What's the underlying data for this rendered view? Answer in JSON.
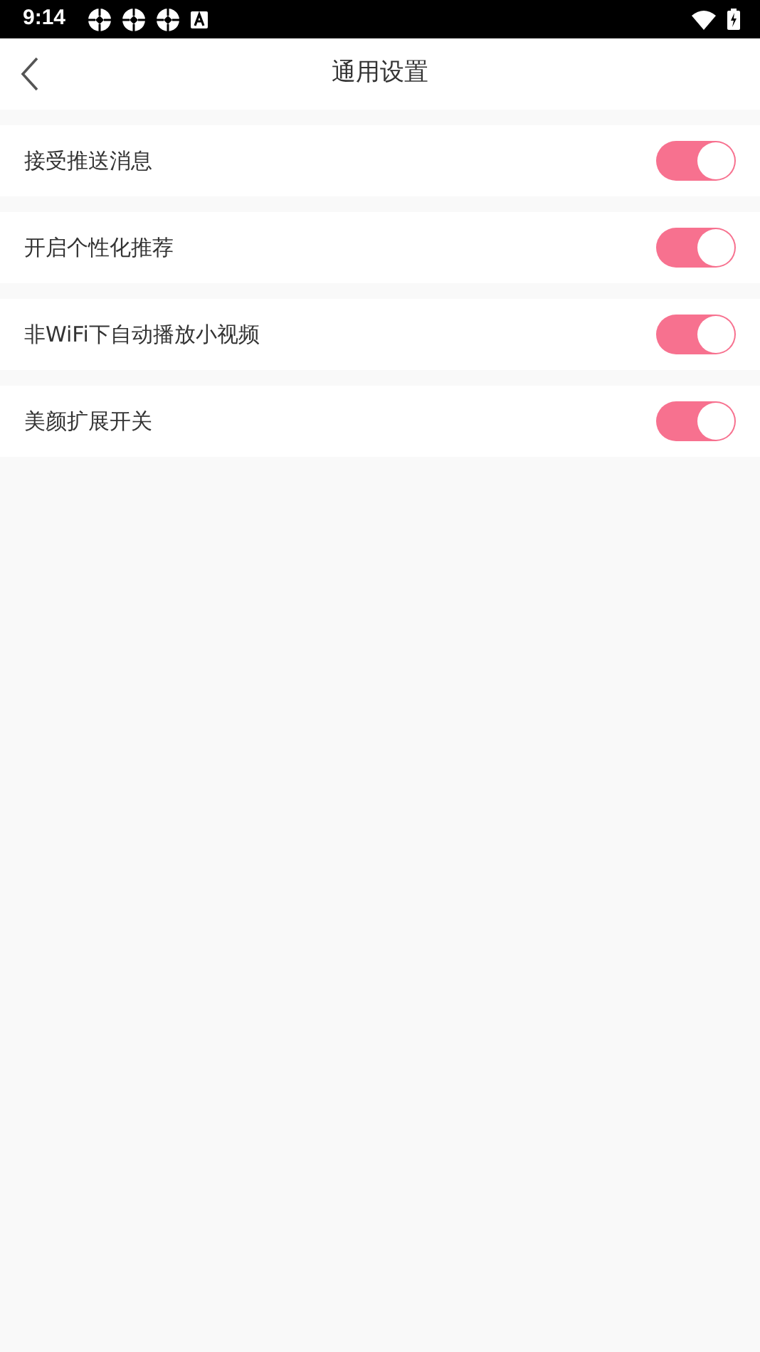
{
  "status_bar": {
    "time": "9:14"
  },
  "header": {
    "title": "通用设置"
  },
  "settings": [
    {
      "label": "接受推送消息",
      "on": true
    },
    {
      "label": "开启个性化推荐",
      "on": true
    },
    {
      "label": "非WiFi下自动播放小视频",
      "on": true
    },
    {
      "label": "美颜扩展开关",
      "on": true
    }
  ]
}
